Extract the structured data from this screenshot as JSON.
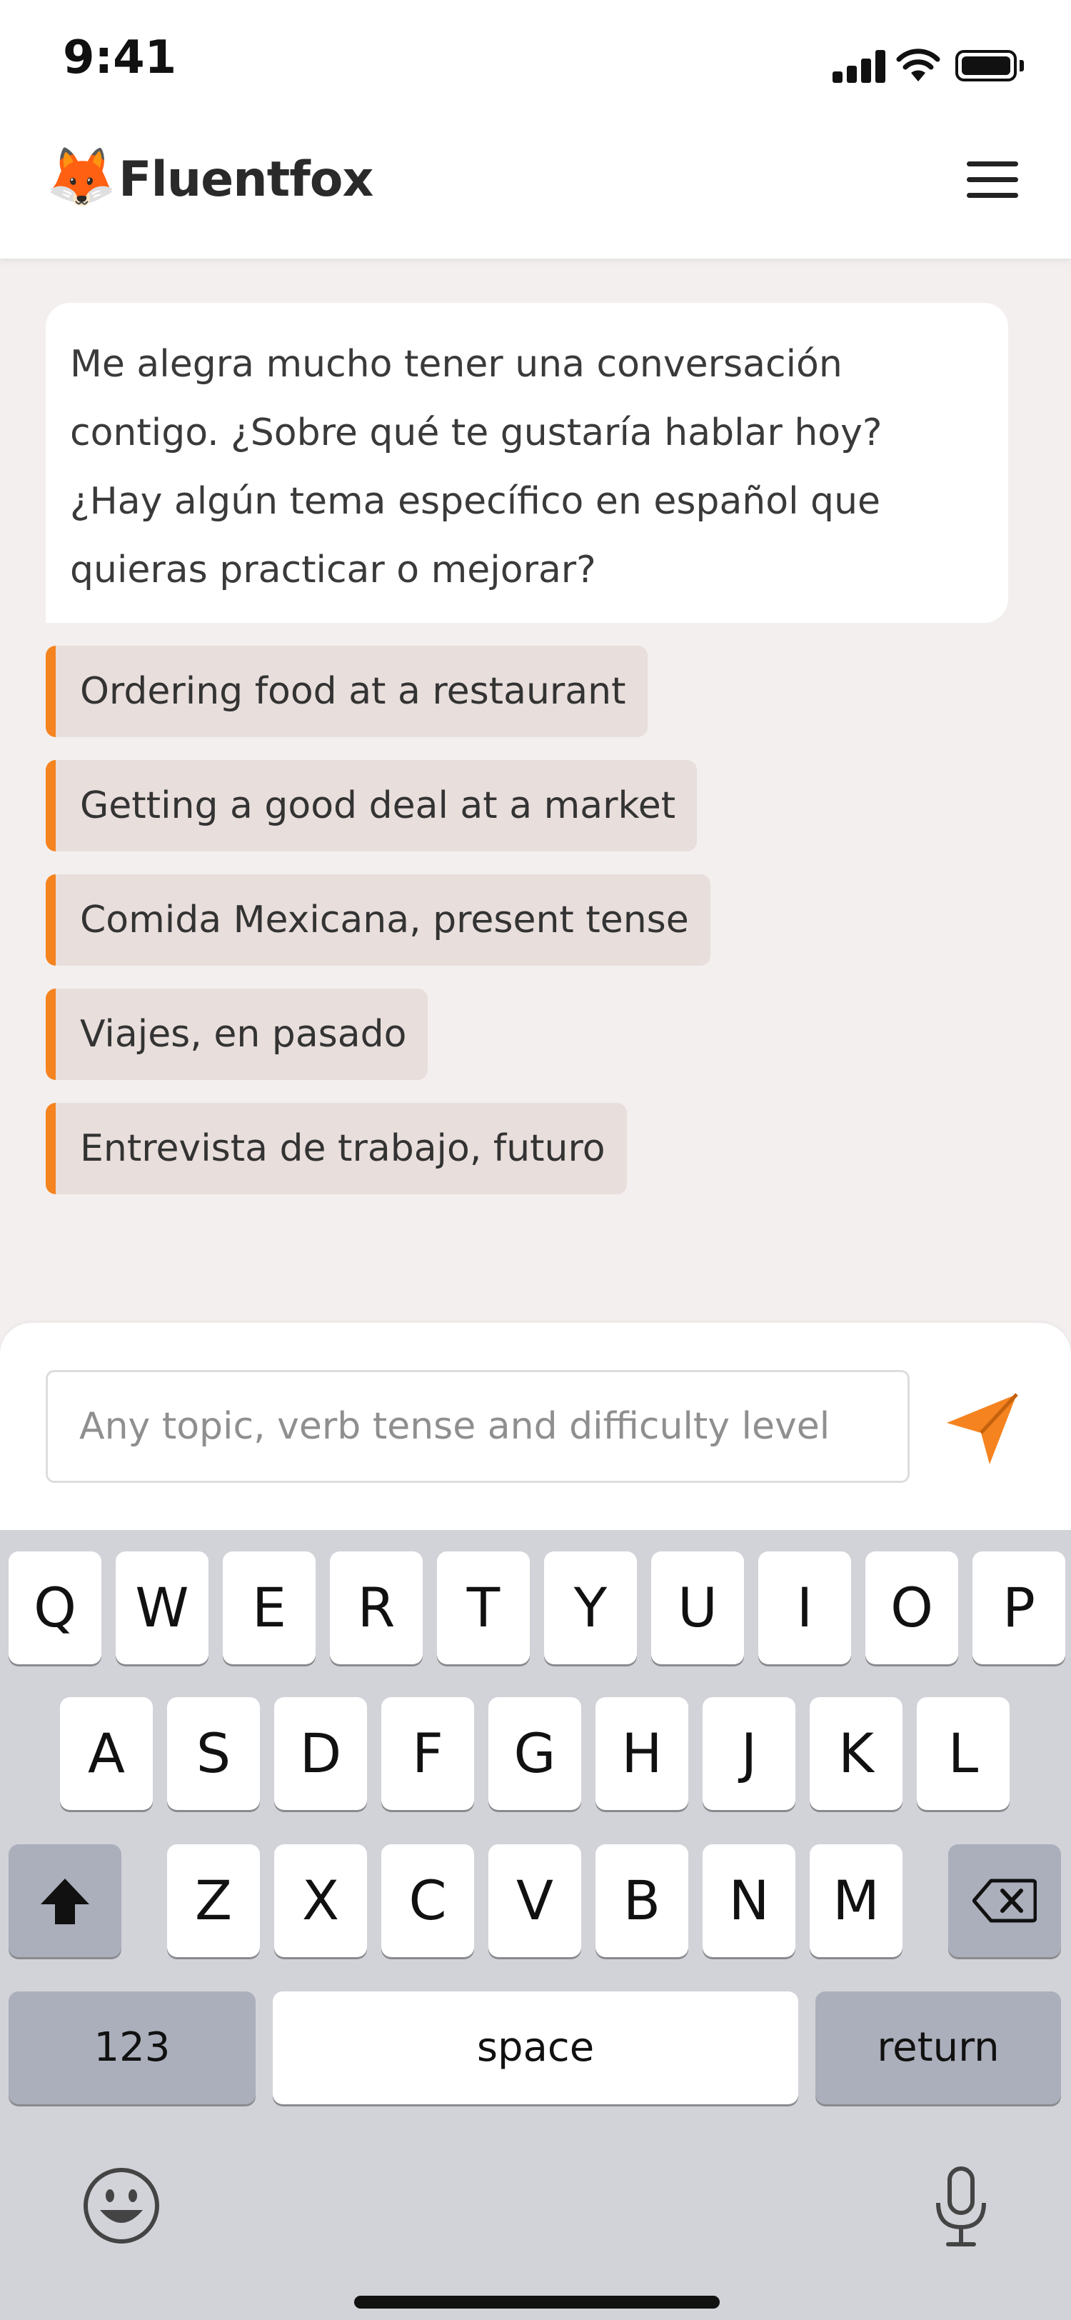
{
  "status_bar": {
    "time": "9:41",
    "signal_icon": "cellular-signal-icon",
    "wifi_icon": "wifi-icon",
    "battery_icon": "battery-icon"
  },
  "header": {
    "logo_icon": "🦊",
    "app_name": "Fluentfox",
    "menu_icon": "hamburger-menu-icon"
  },
  "chat": {
    "assistant_message": "Me alegra mucho tener una conversación contigo. ¿Sobre qué te gustaría hablar hoy? ¿Hay algún tema específico en español que quieras practicar o mejorar?",
    "suggestions": [
      "Ordering food at a restaurant",
      "Getting a good deal at a market",
      "Comida Mexicana, present tense",
      "Viajes, en pasado",
      "Entrevista de trabajo, futuro"
    ]
  },
  "composer": {
    "input_value": "",
    "placeholder": "Any topic, verb tense and difficulty level",
    "send_icon": "send-paper-plane-icon"
  },
  "keyboard": {
    "row1": [
      "Q",
      "W",
      "E",
      "R",
      "T",
      "Y",
      "U",
      "I",
      "O",
      "P"
    ],
    "row2": [
      "A",
      "S",
      "D",
      "F",
      "G",
      "H",
      "J",
      "K",
      "L"
    ],
    "row3": [
      "Z",
      "X",
      "C",
      "V",
      "B",
      "N",
      "M"
    ],
    "shift_icon": "shift-arrow-icon",
    "delete_icon": "backspace-icon",
    "numbers_label": "123",
    "space_label": "space",
    "return_label": "return",
    "emoji_icon": "emoji-icon",
    "mic_icon": "microphone-icon"
  },
  "colors": {
    "accent": "#F5831F",
    "chat_bg": "#F3EFEE",
    "suggestion_bg": "#E8DEDB",
    "keyboard_bg": "#D2D3D9"
  }
}
